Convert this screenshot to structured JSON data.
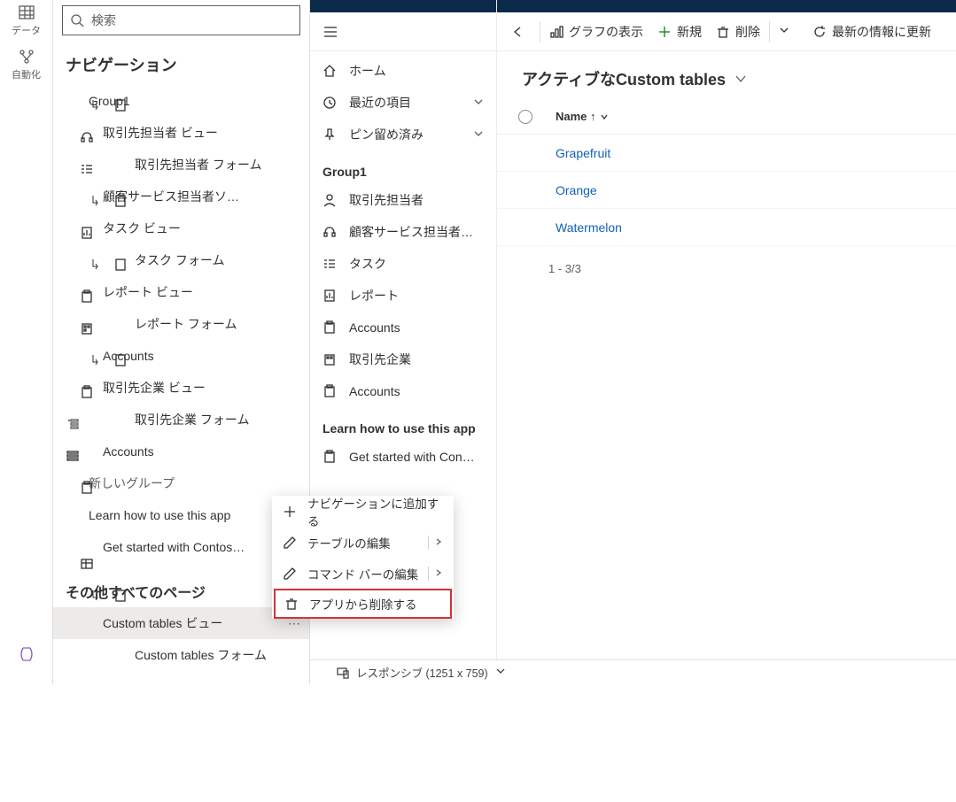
{
  "rail": {
    "data": "データ",
    "automation": "自動化"
  },
  "search": {
    "placeholder": "検索"
  },
  "nav": {
    "heading": "ナビゲーション",
    "group1": "Group1",
    "items": [
      "取引先担当者 ビュー",
      "取引先担当者 フォーム",
      "顧客サービス担当者ソ…",
      "タスク ビュー",
      "タスク フォーム",
      "レポート ビュー",
      "レポート フォーム",
      "Accounts",
      "取引先企業 ビュー",
      "取引先企業 フォーム",
      "Accounts"
    ],
    "newGroup": "新しいグループ",
    "learn": "Learn how to use this app",
    "getStarted": "Get started with Contos…",
    "otherPages": "その他すべてのページ",
    "customView": "Custom tables  ビュー",
    "customForm": "Custom tables  フォーム"
  },
  "sitemap": {
    "home": "ホーム",
    "recent": "最近の項目",
    "pinned": "ピン留め済み",
    "group1": "Group1",
    "items": [
      "取引先担当者",
      "顧客サービス担当者…",
      "タスク",
      "レポート",
      "Accounts",
      "取引先企業",
      "Accounts"
    ],
    "learnHeader": "Learn how to use this app",
    "getStarted": "Get started with Con…"
  },
  "cmd": {
    "back": "",
    "showChart": "グラフの表示",
    "new": "新規",
    "delete": "削除",
    "refresh": "最新の情報に更新"
  },
  "view": {
    "title": "アクティブなCustom tables",
    "nameCol": "Name ↑",
    "rows": [
      "Grapefruit",
      "Orange",
      "Watermelon"
    ],
    "footer": "1 - 3/3"
  },
  "menu": {
    "addNav": "ナビゲーションに追加する",
    "editTable": "テーブルの編集",
    "editCmd": "コマンド バーの編集",
    "remove": "アプリから削除する"
  },
  "status": {
    "text": "レスポンシブ (1251 x 759)"
  }
}
